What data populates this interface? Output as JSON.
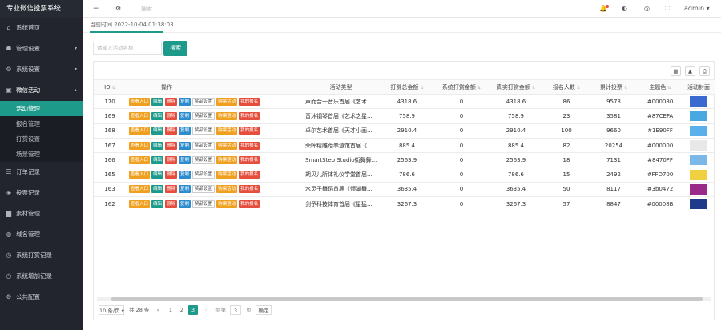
{
  "app": {
    "title": "专业微信投票系统"
  },
  "sidebar": {
    "items": [
      {
        "label": "系统首页",
        "icon": "home-icon",
        "glyph": "⌂"
      },
      {
        "label": "管理设置",
        "icon": "users-icon",
        "glyph": "☗",
        "arrow": "▾"
      },
      {
        "label": "系统设置",
        "icon": "gear-icon",
        "glyph": "⚙",
        "arrow": "▾"
      },
      {
        "label": "微信活动",
        "icon": "briefcase-icon",
        "glyph": "▣",
        "arrow": "▴"
      }
    ],
    "sub_items": [
      "活动管理",
      "报名管理",
      "打赏设置",
      "场景管理"
    ],
    "items2": [
      {
        "label": "订单记录",
        "icon": "list-icon",
        "glyph": "☰"
      },
      {
        "label": "投票记录",
        "icon": "tag-icon",
        "glyph": "◈"
      },
      {
        "label": "素材管理",
        "icon": "folder-icon",
        "glyph": "▆"
      },
      {
        "label": "域名管理",
        "icon": "globe-icon",
        "glyph": "◍"
      },
      {
        "label": "系统打赏记录",
        "icon": "clock-icon",
        "glyph": "◷"
      },
      {
        "label": "系统增加记录",
        "icon": "clock-icon",
        "glyph": "◷"
      },
      {
        "label": "公共配置",
        "icon": "gear-icon",
        "glyph": "⚙"
      }
    ]
  },
  "topbar": {
    "menu_icon": "☰",
    "settings_icon": "⚙",
    "search_placeholder": "搜索",
    "bell_icon": "🔔",
    "theme_icon": "◐",
    "skin_icon": "◎",
    "fullscreen_icon": "⛶",
    "user": "admin",
    "user_caret": "▾"
  },
  "time_label": "当前时间 2022-10-04 01:38:03",
  "search": {
    "placeholder": "请输入活动名称",
    "button": "搜索"
  },
  "toolbar_icons": [
    "▦",
    "▲",
    "⎙"
  ],
  "table": {
    "headers": [
      "ID",
      "操作",
      "活动类型",
      "打赏总金额",
      "系统打赏金额",
      "真实打赏金额",
      "报名人数",
      "累计投票",
      "主题色",
      "活动封面"
    ],
    "action_labels": [
      "查看入口",
      "编辑",
      "删除",
      "复制",
      "奖品设置",
      "购票活动",
      "我的报名"
    ],
    "rows": [
      {
        "id": "170",
        "type": "声而合一音乐首届《艺术...",
        "total": "4318.6",
        "system": "0",
        "real": "4318.6",
        "signups": "86",
        "votes": "9573",
        "color": "#000080",
        "cover": "#3a6ad0"
      },
      {
        "id": "169",
        "type": "音沐钢琴首届《艺术之星...",
        "total": "758.9",
        "system": "0",
        "real": "758.9",
        "signups": "23",
        "votes": "3581",
        "color": "#87CEFA",
        "cover": "#4aa8e0"
      },
      {
        "id": "168",
        "type": "卓尔艺术首届《天才小画...",
        "total": "2910.4",
        "system": "0",
        "real": "2910.4",
        "signups": "100",
        "votes": "9660",
        "color": "#1E90FF",
        "cover": "#5ab0e8"
      },
      {
        "id": "167",
        "type": "荣晖精雕跆拳道馆首届《...",
        "total": "885.4",
        "system": "0",
        "real": "885.4",
        "signups": "82",
        "votes": "20254",
        "color": "#000000",
        "cover": "#e8e8e8"
      },
      {
        "id": "166",
        "type": "SmartStep Studio街舞舞...",
        "total": "2563.9",
        "system": "0",
        "real": "2563.9",
        "signups": "18",
        "votes": "7131",
        "color": "#8470FF",
        "cover": "#7ab8e8"
      },
      {
        "id": "165",
        "type": "胡贝儿所体礼仪学堂首届...",
        "total": "786.6",
        "system": "0",
        "real": "786.6",
        "signups": "15",
        "votes": "2492",
        "color": "#FFD700",
        "cover": "#f0d040"
      },
      {
        "id": "163",
        "type": "水灵子舞蹈首届《倾湖舞...",
        "total": "3635.4",
        "system": "0",
        "real": "3635.4",
        "signups": "50",
        "votes": "8117",
        "color": "#3b0472",
        "cover": "#9a2a8a"
      },
      {
        "id": "162",
        "type": "剑予科技体育首届《星猛...",
        "total": "3267.3",
        "system": "0",
        "real": "3267.3",
        "signups": "57",
        "votes": "8847",
        "color": "#00008B",
        "cover": "#203a8a"
      }
    ]
  },
  "pager": {
    "per_page": "10 条/页",
    "total": "共 28 条",
    "prev": "‹",
    "next": "›",
    "pages": [
      "1",
      "2",
      "3"
    ],
    "current": "3",
    "goto_label": "到第",
    "goto_value": "3",
    "page_unit": "页",
    "confirm": "确定"
  }
}
